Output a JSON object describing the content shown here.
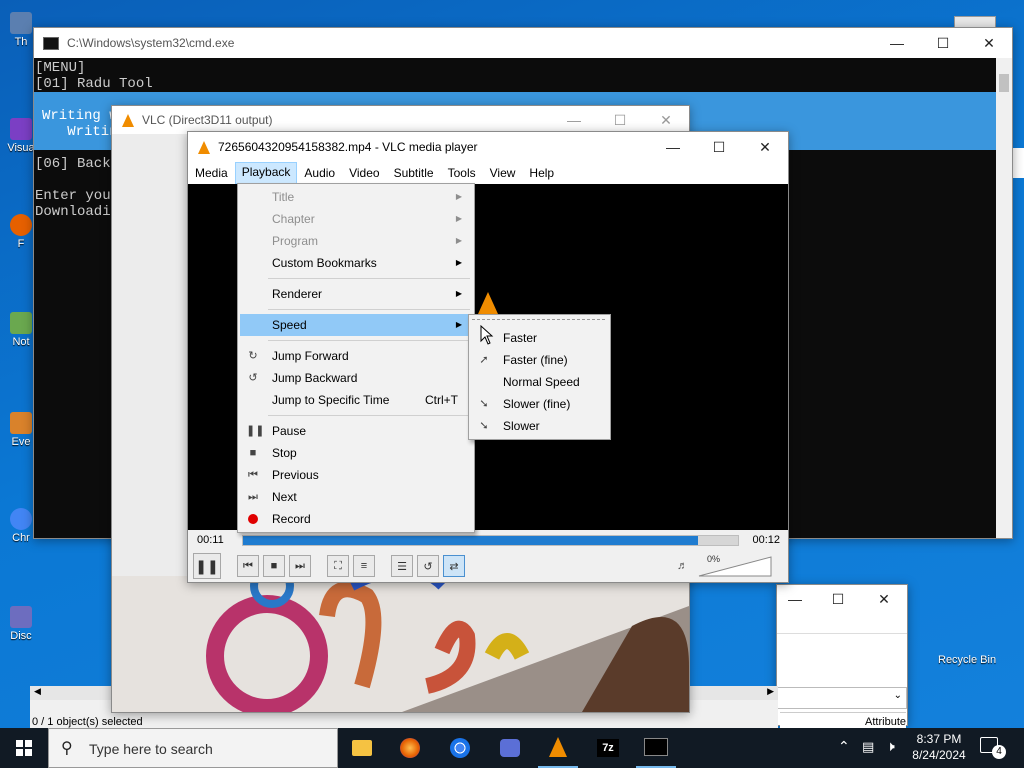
{
  "desktop": {
    "icons": [
      {
        "label": "Th",
        "color": "#5b7fb0"
      },
      {
        "label": "Visua",
        "color": "#7b3fc4"
      },
      {
        "label": "F",
        "color": "#e66000"
      },
      {
        "label": "Not",
        "color": "#6aa84f"
      },
      {
        "label": "Eve",
        "color": "#d9822b"
      },
      {
        "label": "Chr",
        "color": "#4285f4"
      },
      {
        "label": "Disc",
        "color": "#6d6dbf"
      }
    ],
    "recycle_bin": "Recycle Bin"
  },
  "cmd": {
    "title": "C:\\Windows\\system32\\cmd.exe",
    "lines": {
      "l1": "[MENU]",
      "l2": "[01] Radu Tool",
      "l3": "Writing w",
      "l4": "   Writin",
      "l5": "[06] Backu",
      "l6": "Enter your",
      "l7": "Downloadin"
    }
  },
  "vlc_direct3d": {
    "title": "VLC (Direct3D11 output)"
  },
  "explorer": {
    "status": "0 / 1 object(s) selected",
    "column": "Attribute"
  },
  "vlc": {
    "title": "7265604320954158382.mp4 - VLC media player",
    "menubar": [
      "Media",
      "Playback",
      "Audio",
      "Video",
      "Subtitle",
      "Tools",
      "View",
      "Help"
    ],
    "playback_menu": {
      "title": "Title",
      "chapter": "Chapter",
      "program": "Program",
      "custom_bookmarks": "Custom Bookmarks",
      "renderer": "Renderer",
      "speed": "Speed",
      "jump_forward": "Jump Forward",
      "jump_backward": "Jump Backward",
      "jump_specific": "Jump to Specific Time",
      "jump_specific_shortcut": "Ctrl+T",
      "pause": "Pause",
      "stop": "Stop",
      "previous": "Previous",
      "next": "Next",
      "record": "Record"
    },
    "speed_menu": {
      "faster": "Faster",
      "faster_fine": "Faster (fine)",
      "normal": "Normal Speed",
      "slower_fine": "Slower (fine)",
      "slower": "Slower"
    },
    "time_elapsed": "00:11",
    "time_total": "00:12",
    "progress": 0.92,
    "volume": "0%",
    "record_color": "#e00000",
    "seek_color": "#1f7cd0"
  },
  "taskbar": {
    "search_placeholder": "Type here to search",
    "time": "8:37 PM",
    "date": "8/24/2024",
    "notification_count": "4"
  }
}
